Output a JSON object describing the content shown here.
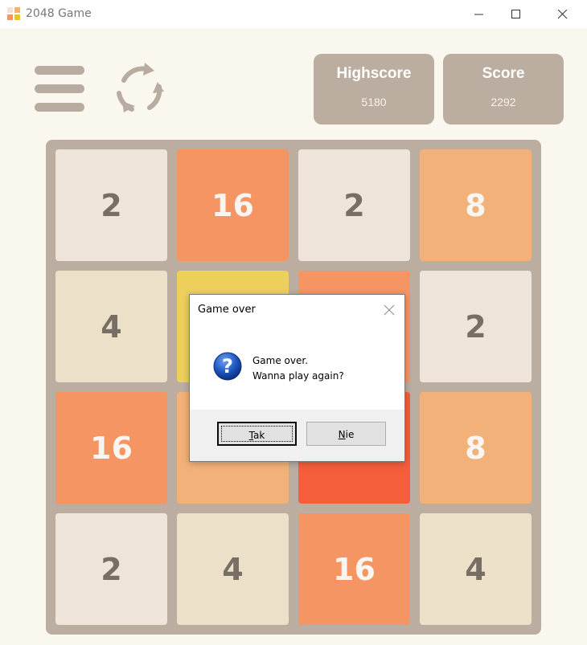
{
  "window": {
    "title": "2048 Game"
  },
  "header": {
    "highscore_label": "Highscore",
    "highscore_value": "5180",
    "score_label": "Score",
    "score_value": "2292"
  },
  "board": {
    "tiles": [
      [
        "2",
        "16",
        "2",
        "8"
      ],
      [
        "4",
        "",
        "",
        "2"
      ],
      [
        "16",
        "",
        "",
        "8"
      ],
      [
        "2",
        "4",
        "16",
        "4"
      ]
    ]
  },
  "colors": {
    "tile_2": "#eee4da",
    "tile_4": "#ede0c8",
    "tile_8": "#f2b179",
    "tile_16": "#f59563",
    "tile_32": "#f67c5f",
    "tile_64": "#f65e3b",
    "text_dark": "#776e65",
    "text_light": "#f9f6f2",
    "board_bg": "#bbada0"
  },
  "dialog": {
    "title": "Game over",
    "message_line1": "Game over.",
    "message_line2": "Wanna play again?",
    "yes_prefix": "T",
    "yes_rest": "ak",
    "no_prefix": "N",
    "no_rest": "ie",
    "icon": "question-icon"
  }
}
